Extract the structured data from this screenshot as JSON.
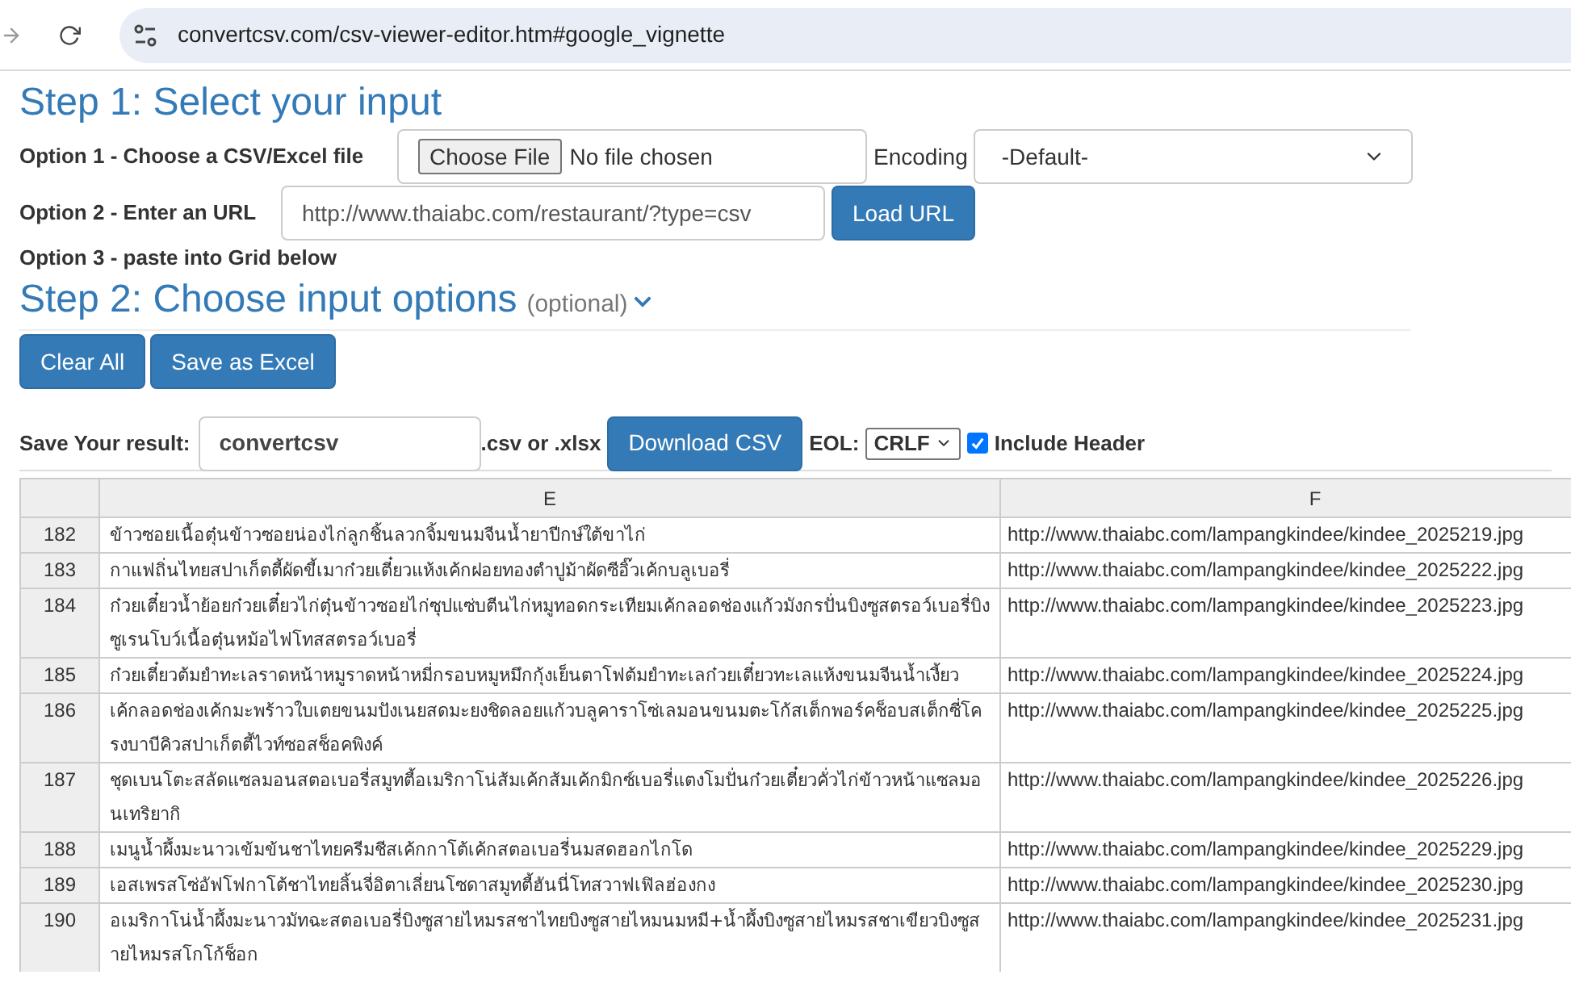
{
  "browser": {
    "url": "convertcsv.com/csv-viewer-editor.htm#google_vignette"
  },
  "step1": {
    "title": "Step 1: Select your input",
    "option1_label": "Option 1 - Choose a CSV/Excel file",
    "choose_file": "Choose File",
    "file_status": "No file chosen",
    "encoding_label": "Encoding",
    "encoding_value": "-Default-",
    "option2_label": "Option 2 - Enter an URL",
    "url_value": "http://www.thaiabc.com/restaurant/?type=csv",
    "load_url": "Load URL",
    "option3_label": "Option 3 - paste into Grid below"
  },
  "step2": {
    "title": "Step 2: Choose input options",
    "subtitle": "(optional)"
  },
  "buttons": [
    "Clear All",
    "Save as Excel"
  ],
  "save": {
    "label": "Save Your result:",
    "filename": "convertcsv",
    "extension": ".csv or .xlsx",
    "download": "Download CSV",
    "eol_label": "EOL:",
    "eol_value": "CRLF",
    "include_header": {
      "label": "Include Header",
      "checked": true
    }
  },
  "table": {
    "columns": [
      "E",
      "F"
    ],
    "rows": [
      {
        "number": "182",
        "e": "ข้าวซอยเนื้อตุ๋นข้าวซอยน่องไก่ลูกชิ้นลวกจิ้มขนมจีนน้ำยาปีกษ์ใต้ขาไก่",
        "f": "http://www.thaiabc.com/lampangkindee/kindee_2025219.jpg"
      },
      {
        "number": "183",
        "e": "กาแฟถิ่นไทยสปาเก็ตตี้ผัดขี้เมาก๋วยเตี๋ยวแห้งเค้กฝอยทองตำปูม้าผัดซีอิ๊วเค้กบลูเบอรี่",
        "f": "http://www.thaiabc.com/lampangkindee/kindee_2025222.jpg"
      },
      {
        "number": "184",
        "e": "ก๋วยเตี๋ยวน้ำย้อยก๋วยเตี๋ยวไก่ตุ๋นข้าวซอยไก่ซุปแซ่บตีนไก่หมูทอดกระเทียมเค้กลอดช่องแก้วมังกรปั่นบิงซูสตรอว์เบอรี่บิงซูเรนโบว์เนื้อตุ๋นหม้อไฟโทสสตรอว์เบอรี่",
        "f": "http://www.thaiabc.com/lampangkindee/kindee_2025223.jpg"
      },
      {
        "number": "185",
        "e": "ก๋วยเตี๋ยวต้มยำทะเลราดหน้าหมูราดหน้าหมี่กรอบหมูหมึกกุ้งเย็นตาโฟต้มยำทะเลก๋วยเตี๋ยวทะเลแห้งขนมจีนน้ำเงี้ยว",
        "f": "http://www.thaiabc.com/lampangkindee/kindee_2025224.jpg"
      },
      {
        "number": "186",
        "e": "เค้กลอดช่องเค้กมะพร้าวใบเตยขนมปังเนยสดมะยงชิดลอยแก้วบลูคาราโซ่เลมอนขนมตะโก้สเต็กพอร์คช็อบสเต็กซี่โครงบาบีคิวสปาเก็ตตี้ไวท์ซอสช็อคพิงค์",
        "f": "http://www.thaiabc.com/lampangkindee/kindee_2025225.jpg"
      },
      {
        "number": "187",
        "e": "ชุดเบนโตะสลัดแซลมอนสตอเบอรี่สมูทตี้อเมริกาโน่ส้มเค้กส้มเค้กมิกซ์เบอรี่แตงโมปั่นก๋วยเตี๋ยวคั่วไก่ข้าวหน้าแซลมอนเทริยากิ",
        "f": "http://www.thaiabc.com/lampangkindee/kindee_2025226.jpg"
      },
      {
        "number": "188",
        "e": "เมนูน้ำผึ้งมะนาวเข้มข้นชาไทยครีมชีสเค้กกาโต้เค้กสตอเบอรี่นมสดฮอกไกโด",
        "f": "http://www.thaiabc.com/lampangkindee/kindee_2025229.jpg"
      },
      {
        "number": "189",
        "e": "เอสเพรสโซ่อัฟโฟกาโต้ชาไทยลิ้นจี่อิตาเลี่ยนโซดาสมูทตี้ฮันนี่โทสวาฟเฟิลฮ่องกง",
        "f": "http://www.thaiabc.com/lampangkindee/kindee_2025230.jpg"
      },
      {
        "number": "190",
        "e": "อเมริกาโน่น้ำผึ้งมะนาวมัทฉะสตอเบอรี่บิงซูสายไหมรสชาไทยบิงซูสายไหมนมหมี+น้ำผึ้งบิงซูสายไหมรสชาเขียวบิงซูสายไหมรสโกโก้ช็อก",
        "f": "http://www.thaiabc.com/lampangkindee/kindee_2025231.jpg"
      }
    ]
  }
}
